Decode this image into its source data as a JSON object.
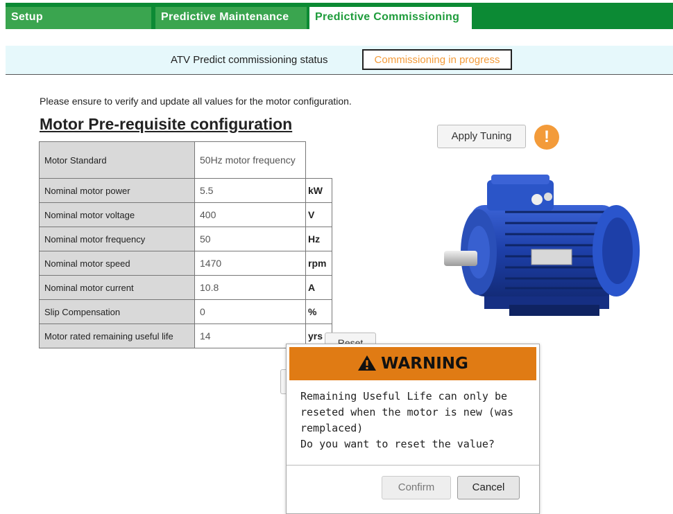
{
  "tabs": {
    "setup": "Setup",
    "predictive_maintenance": "Predictive Maintenance",
    "predictive_commissioning": "Predictive Commissioning"
  },
  "status": {
    "label": "ATV Predict commissioning status",
    "value": "Commissioning in progress"
  },
  "note": "Please ensure to verify and update all values for the motor configuration.",
  "heading": "Motor Pre-requisite configuration",
  "rows": [
    {
      "label": "Motor Standard",
      "value": "50Hz motor frequency",
      "unit": ""
    },
    {
      "label": "Nominal motor power",
      "value": "5.5",
      "unit": "kW"
    },
    {
      "label": "Nominal motor voltage",
      "value": "400",
      "unit": "V"
    },
    {
      "label": "Nominal motor frequency",
      "value": "50",
      "unit": "Hz"
    },
    {
      "label": "Nominal motor speed",
      "value": "1470",
      "unit": "rpm"
    },
    {
      "label": "Nominal motor current",
      "value": "10.8",
      "unit": "A"
    },
    {
      "label": "Slip Compensation",
      "value": "0",
      "unit": "%"
    },
    {
      "label": "Motor rated remaining useful life",
      "value": "14",
      "unit": "yrs"
    }
  ],
  "reset_button": "Reset",
  "apply_button": "Apply Tuning",
  "alert_glyph": "!",
  "colors": {
    "tab_bar": "#0c8a34",
    "tab_inactive": "#3aa54f",
    "tab_active_text": "#1e9c3b",
    "status_bg": "#e6f8fb",
    "status_value": "#f39b3a",
    "warning_header": "#e07b14",
    "motor_blue": "#1d3fa8"
  },
  "icons": {
    "alert": "exclamation-circle-icon",
    "warning": "warning-triangle-icon"
  },
  "dialog": {
    "title": "WARNING",
    "message_lines": [
      "Remaining Useful Life can only be",
      "reseted when the motor is new (was",
      "remplaced)",
      "Do you want to reset the value?"
    ],
    "confirm": "Confirm",
    "cancel": "Cancel"
  }
}
